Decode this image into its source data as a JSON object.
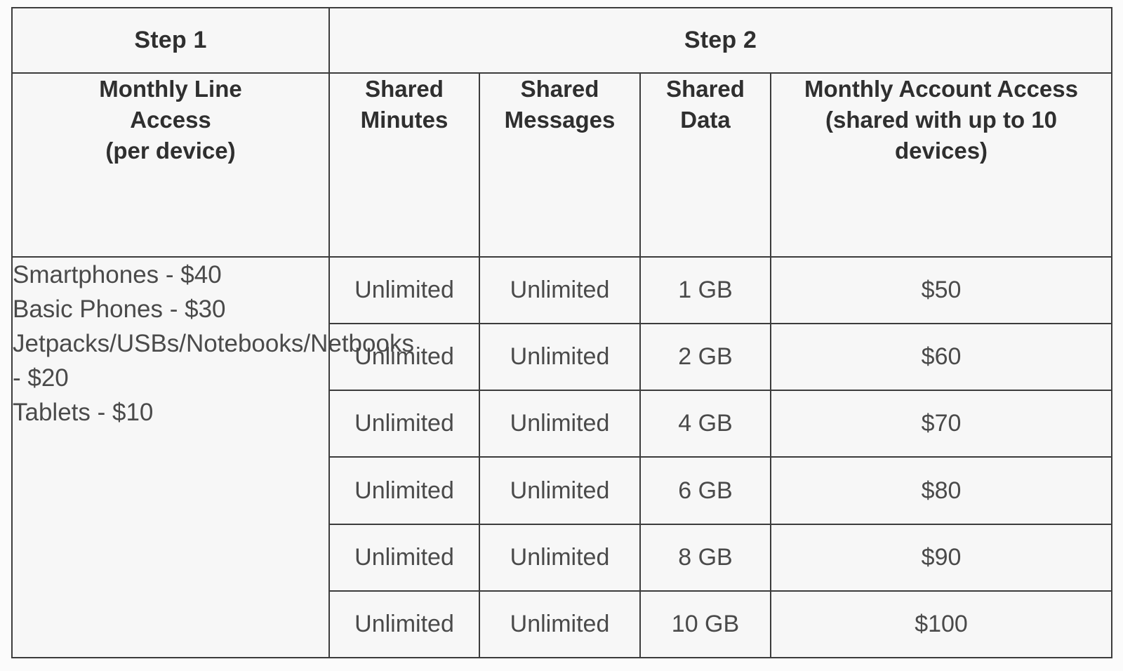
{
  "table": {
    "step_headers": [
      {
        "label": "Step 1",
        "span": 1
      },
      {
        "label": "Step 2",
        "span": 4
      }
    ],
    "column_headers": [
      "Monthly Line Access (per device)",
      "Shared Minutes",
      "Shared Messages",
      "Shared Data",
      "Monthly Account Access (shared with up to 10 devices)"
    ],
    "column_header_lines": {
      "device": [
        "Monthly Line",
        "Access",
        "(per device)"
      ],
      "minutes": [
        "Shared",
        "Minutes"
      ],
      "messages": [
        "Shared",
        "Messages"
      ],
      "data": [
        "Shared",
        "Data"
      ],
      "access": [
        "Monthly Account Access (shared with up to 10 devices)"
      ]
    },
    "device_pricing_lines": [
      "Smartphones - $40",
      "Basic Phones - $30",
      "Jetpacks/USBs/Notebooks/Netbooks - $20",
      "Tablets - $10"
    ],
    "rows": [
      {
        "minutes": "Unlimited",
        "messages": "Unlimited",
        "data": "1 GB",
        "access": "$50"
      },
      {
        "minutes": "Unlimited",
        "messages": "Unlimited",
        "data": "2 GB",
        "access": "$60"
      },
      {
        "minutes": "Unlimited",
        "messages": "Unlimited",
        "data": "4 GB",
        "access": "$70"
      },
      {
        "minutes": "Unlimited",
        "messages": "Unlimited",
        "data": "6 GB",
        "access": "$80"
      },
      {
        "minutes": "Unlimited",
        "messages": "Unlimited",
        "data": "8 GB",
        "access": "$90"
      },
      {
        "minutes": "Unlimited",
        "messages": "Unlimited",
        "data": "10 GB",
        "access": "$100"
      }
    ],
    "colors": {
      "border": "#3c3c3c",
      "cell_background": "#f7f7f7",
      "page_background": "#fbfbfb",
      "header_text": "#2f2f2f",
      "body_text": "#4a4a4a"
    }
  }
}
